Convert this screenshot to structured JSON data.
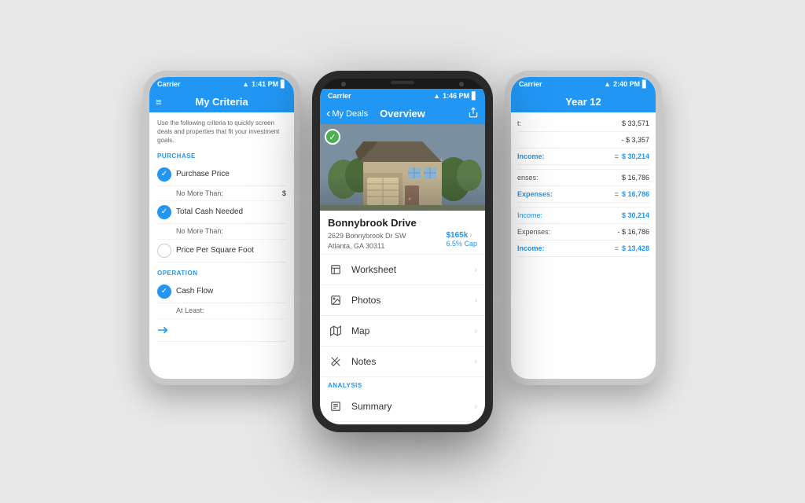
{
  "background": "#e8e8e8",
  "phones": {
    "left": {
      "status": {
        "carrier": "Carrier",
        "time": "1:41 PM",
        "wifi": "wifi",
        "battery": "battery"
      },
      "nav": {
        "title": "My Criteria",
        "menu_icon": "≡"
      },
      "body": {
        "description": "Use the following criteria to quickly screen deals and properties that fit your investment goals.",
        "sections": [
          {
            "label": "PURCHASE",
            "items": [
              {
                "type": "checked",
                "label": "Purchase Price"
              },
              {
                "type": "sub",
                "label": "No More Than:",
                "value": "$"
              },
              {
                "type": "checked",
                "label": "Total Cash Needed"
              },
              {
                "type": "sub",
                "label": "No More Than:",
                "value": ""
              },
              {
                "type": "empty",
                "label": "Price Per Square Foot"
              }
            ]
          },
          {
            "label": "OPERATION",
            "items": [
              {
                "type": "checked",
                "label": "Cash Flow"
              },
              {
                "type": "sub",
                "label": "At Least:",
                "value": ""
              }
            ]
          }
        ]
      }
    },
    "center": {
      "status": {
        "carrier": "Carrier",
        "time": "1:46 PM",
        "wifi": "wifi",
        "battery": "battery"
      },
      "nav": {
        "back_label": "My Deals",
        "title": "Overview",
        "share_icon": "share"
      },
      "property": {
        "name": "Bonnybrook Drive",
        "address_line1": "2629 Bonnybrook Dr SW",
        "address_line2": "Atlanta, GA 30311",
        "price": "$165k",
        "cap_rate": "6.5% Cap"
      },
      "menu_items": [
        {
          "icon": "worksheet",
          "label": "Worksheet"
        },
        {
          "icon": "photos",
          "label": "Photos"
        },
        {
          "icon": "map",
          "label": "Map"
        },
        {
          "icon": "notes",
          "label": "Notes"
        }
      ],
      "analysis_label": "ANALYSIS",
      "analysis_items": [
        {
          "icon": "summary",
          "label": "Summary"
        }
      ]
    },
    "right": {
      "status": {
        "carrier": "Carrier",
        "time": "2:40 PM",
        "wifi": "wifi",
        "battery": "battery"
      },
      "nav": {
        "title": "Year 12"
      },
      "rows": [
        {
          "label": "t:",
          "value": "$ 33,571",
          "type": "normal"
        },
        {
          "label": "",
          "value": "- $ 3,357",
          "type": "normal"
        },
        {
          "label": "Income:",
          "value": "= $ 30,214",
          "type": "highlight",
          "eq": "="
        },
        {
          "label": "",
          "value": "",
          "type": "spacer"
        },
        {
          "label": "enses:",
          "value": "$ 16,786",
          "type": "normal"
        },
        {
          "label": "Expenses:",
          "value": "= $ 16,786",
          "type": "highlight",
          "eq": "="
        },
        {
          "label": "",
          "value": "",
          "type": "spacer"
        },
        {
          "label": "Income:",
          "value": "$ 30,214",
          "type": "normal",
          "blue": true
        },
        {
          "label": "Expenses:",
          "value": "- $ 16,786",
          "type": "normal"
        },
        {
          "label": "Income:",
          "value": "$ 13,428",
          "type": "highlight-blue",
          "eq": "="
        }
      ]
    }
  }
}
